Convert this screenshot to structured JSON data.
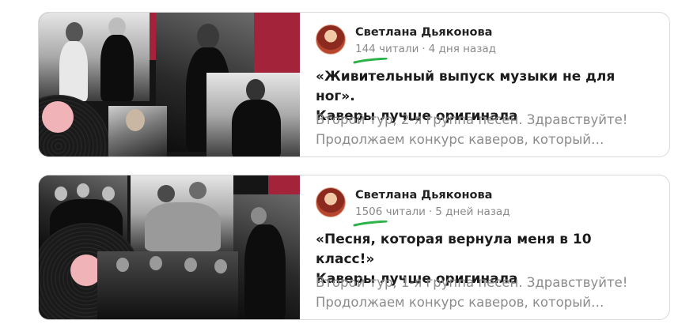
{
  "feed": {
    "cards": [
      {
        "author": "Светлана Дьяконова",
        "readers": "144 читали",
        "age": "4 дня назад",
        "title_line1": "«Живительный выпуск музыки не для ног».",
        "title_line2": "Каверы лучше оригинала",
        "snippet_line1": "Второй тур, 2-я группа песен. Здравствуйте!",
        "snippet_line2": "Продолжаем конкурс каверов, который…"
      },
      {
        "author": "Светлана Дьяконова",
        "readers": "1506 читали",
        "age": "5 дней назад",
        "title_line1": "«Песня, которая вернула меня в 10 класс!»",
        "title_line2": "Каверы лучше оригинала",
        "snippet_line1": "Второй тур, 1-я группа песен. Здравствуйте!",
        "snippet_line2": "Продолжаем конкурс каверов, который…"
      }
    ],
    "meta_separator": "·"
  },
  "colors": {
    "accent_red": "#a3243a",
    "highlight_green": "#2bb34a",
    "meta_gray": "#8a8a8a"
  }
}
